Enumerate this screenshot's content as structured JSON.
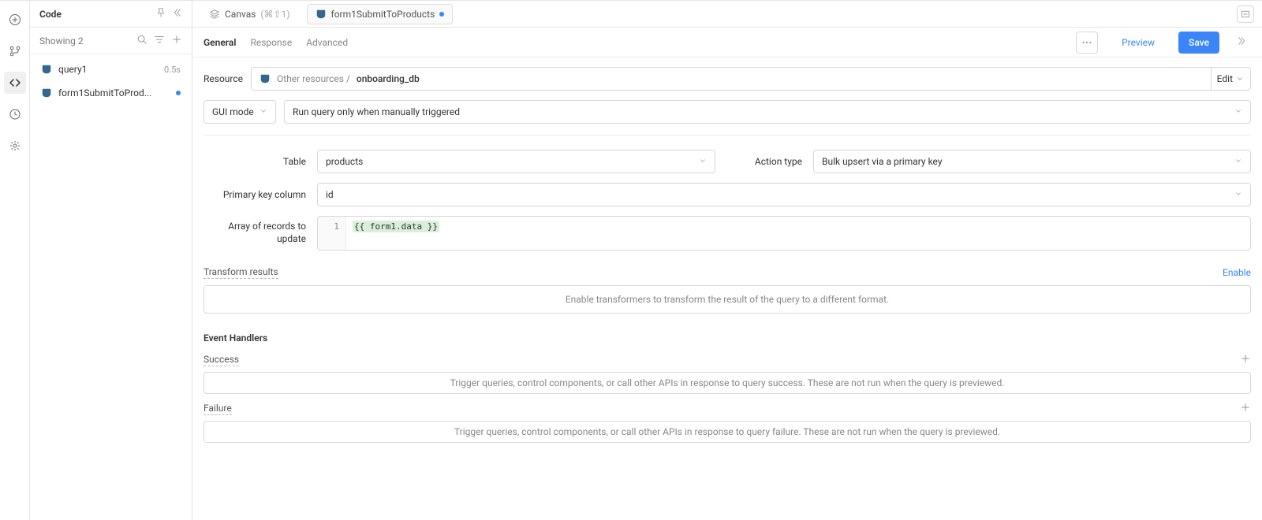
{
  "sidebar": {
    "title": "Code",
    "showing": "Showing 2",
    "items": [
      {
        "label": "query1",
        "meta": "0.5s",
        "modified": false
      },
      {
        "label": "form1SubmitToProd...",
        "meta": "",
        "modified": true
      }
    ]
  },
  "tabs": {
    "canvas": "Canvas",
    "canvas_shortcut": "(⌘⇧1)",
    "active": "form1SubmitToProducts"
  },
  "subtabs": {
    "general": "General",
    "response": "Response",
    "advanced": "Advanced"
  },
  "actions": {
    "preview": "Preview",
    "save": "Save"
  },
  "resource": {
    "label": "Resource",
    "prefix": "Other resources / ",
    "name": "onboarding_db",
    "edit": "Edit"
  },
  "mode": {
    "gui": "GUI mode",
    "run": "Run query only when manually triggered"
  },
  "fields": {
    "table_label": "Table",
    "table_value": "products",
    "action_type_label": "Action type",
    "action_type_value": "Bulk upsert via a primary key",
    "pk_label": "Primary key column",
    "pk_value": "id",
    "array_label": "Array of records to update",
    "array_code": "{{ form1.data }}",
    "line_no": "1"
  },
  "transform": {
    "title": "Transform results",
    "enable": "Enable",
    "description": "Enable transformers to transform the result of the query to a different format."
  },
  "event_handlers": {
    "title": "Event Handlers",
    "success": "Success",
    "success_desc": "Trigger queries, control components, or call other APIs in response to query success. These are not run when the query is previewed.",
    "failure": "Failure",
    "failure_desc": "Trigger queries, control components, or call other APIs in response to query failure. These are not run when the query is previewed."
  }
}
